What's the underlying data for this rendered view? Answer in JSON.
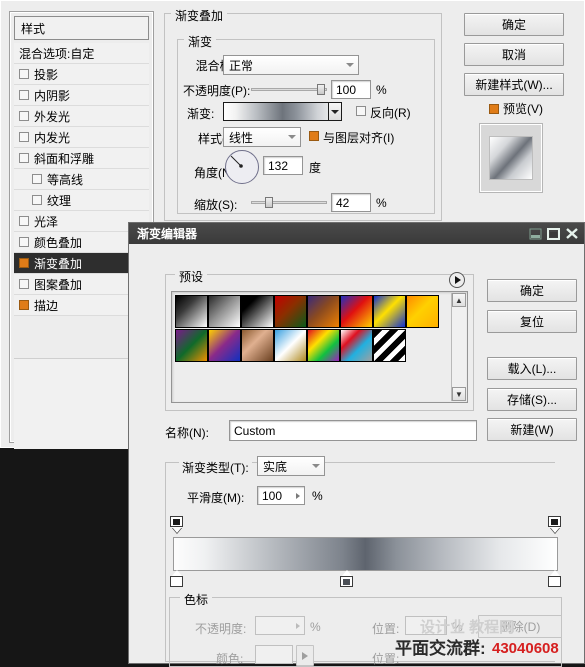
{
  "layer_style": {
    "styles_panel": {
      "header": "样式",
      "items": [
        {
          "label": "混合选项:自定",
          "checkbox": false,
          "sub": false,
          "selected": false,
          "has_checkbox": false
        },
        {
          "label": "投影",
          "checkbox": false,
          "sub": false,
          "selected": false,
          "has_checkbox": true
        },
        {
          "label": "内阴影",
          "checkbox": false,
          "sub": false,
          "selected": false,
          "has_checkbox": true
        },
        {
          "label": "外发光",
          "checkbox": false,
          "sub": false,
          "selected": false,
          "has_checkbox": true
        },
        {
          "label": "内发光",
          "checkbox": false,
          "sub": false,
          "selected": false,
          "has_checkbox": true
        },
        {
          "label": "斜面和浮雕",
          "checkbox": false,
          "sub": false,
          "selected": false,
          "has_checkbox": true
        },
        {
          "label": "等高线",
          "checkbox": false,
          "sub": true,
          "selected": false,
          "has_checkbox": true
        },
        {
          "label": "纹理",
          "checkbox": false,
          "sub": true,
          "selected": false,
          "has_checkbox": true
        },
        {
          "label": "光泽",
          "checkbox": false,
          "sub": false,
          "selected": false,
          "has_checkbox": true
        },
        {
          "label": "颜色叠加",
          "checkbox": false,
          "sub": false,
          "selected": false,
          "has_checkbox": true
        },
        {
          "label": "渐变叠加",
          "checkbox": true,
          "sub": false,
          "selected": true,
          "has_checkbox": true
        },
        {
          "label": "图案叠加",
          "checkbox": false,
          "sub": false,
          "selected": false,
          "has_checkbox": true
        },
        {
          "label": "描边",
          "checkbox": true,
          "sub": false,
          "selected": false,
          "has_checkbox": true
        }
      ]
    },
    "gradient_overlay": {
      "group_title": "渐变叠加",
      "subgroup_title": "渐变",
      "blend_mode_label": "混合模式:",
      "blend_mode_value": "正常",
      "opacity_label": "不透明度(P):",
      "opacity_value": "100",
      "opacity_unit": "%",
      "gradient_label": "渐变:",
      "reverse_label": "反向(R)",
      "reverse_checked": false,
      "style_label": "样式(L):",
      "style_value": "线性",
      "align_label": "与图层对齐(I)",
      "align_checked": true,
      "angle_label": "角度(N):",
      "angle_value": "132",
      "angle_unit": "度",
      "scale_label": "缩放(S):",
      "scale_value": "42",
      "scale_unit": "%"
    },
    "buttons": {
      "ok": "确定",
      "cancel": "取消",
      "new_style": "新建样式(W)...",
      "preview": "预览(V)",
      "preview_checked": true
    }
  },
  "gradient_editor": {
    "title": "渐变编辑器",
    "window_buttons": {
      "minimize": "_",
      "maximize": "▫",
      "close": "✕"
    },
    "presets": {
      "label": "预设",
      "swatches": [
        {
          "name": "foreground-to-background",
          "css": "linear-gradient(135deg,#000 0%,#3a3a3a 35%,#ffffff 100%)"
        },
        {
          "name": "foreground-to-transparent",
          "css": "linear-gradient(135deg,#2a2a2a 0%,#8f8f8f 45%,#ffffff 100%)"
        },
        {
          "name": "black-white",
          "css": "linear-gradient(135deg,#000000 0%,#000000 25%,#ffffff 100%)"
        },
        {
          "name": "red-green",
          "css": "linear-gradient(135deg,#c40000 0%,#8a2f00 45%,#0a5a1a 100%)"
        },
        {
          "name": "violet-orange",
          "css": "linear-gradient(135deg,#3a2a7a 0%,#8a4a20 45%,#f08000 100%)"
        },
        {
          "name": "blue-red-yellow",
          "css": "linear-gradient(135deg,#2030c0 0%,#e01010 45%,#ffd000 100%)"
        },
        {
          "name": "blue-yellow-blue",
          "css": "linear-gradient(135deg,#1030d0 0%,#ffe000 45%,#1030d0 100%)"
        },
        {
          "name": "orange-yellow-orange",
          "css": "linear-gradient(135deg,#ff8a00 0%,#ffd000 45%,#ffb000 100%)"
        },
        {
          "name": "violet-green-orange",
          "css": "linear-gradient(135deg,#7a1a8a 0%,#0f6a2a 50%,#f09000 100%)"
        },
        {
          "name": "yellow-violet-blue",
          "css": "linear-gradient(135deg,#ffd000 0%,#8a2a8a 48%,#1030c0 100%)"
        },
        {
          "name": "copper",
          "css": "linear-gradient(135deg,#8a5a30 0%,#e0b090 40%,#6a4020 100%)"
        },
        {
          "name": "chrome",
          "css": "linear-gradient(135deg,#3aa0e0 0%,#ffffff 50%,#b08a20 100%)"
        },
        {
          "name": "spectrum",
          "css": "linear-gradient(135deg,#e01020 0%,#ffe000 35%,#10c040 65%,#a020c0 100%)"
        },
        {
          "name": "transparent-rainbow",
          "css": "linear-gradient(135deg,#ffffff 0%,#e01020 30%,#20b0e0 60%,#a0a0a0 100%)"
        },
        {
          "name": "transparent-stripes",
          "css": "repeating-linear-gradient(135deg,#000 0 6px,#fff 6px 11px)"
        }
      ]
    },
    "name_label": "名称(N):",
    "name_value": "Custom",
    "new_button": "新建(W)",
    "gradient_type_label": "渐变类型(T):",
    "gradient_type_value": "实底",
    "smoothness_label": "平滑度(M):",
    "smoothness_value": "100",
    "smoothness_unit": "%",
    "buttons": {
      "ok": "确定",
      "reset": "复位",
      "load": "载入(L)...",
      "save": "存储(S)..."
    },
    "stops": {
      "group_label": "色标",
      "opacity_label": "不透明度:",
      "opacity_value": "",
      "opacity_unit": "%",
      "position_label_1": "位置:",
      "position_value_1": "",
      "position_unit_1": "%",
      "delete_label": "删除(D)",
      "color_label": "颜色:",
      "position_label_2": "位置:"
    }
  },
  "watermark": {
    "text": "平面交流群:",
    "number": "43040608",
    "ghost": "设计业 教程网"
  }
}
